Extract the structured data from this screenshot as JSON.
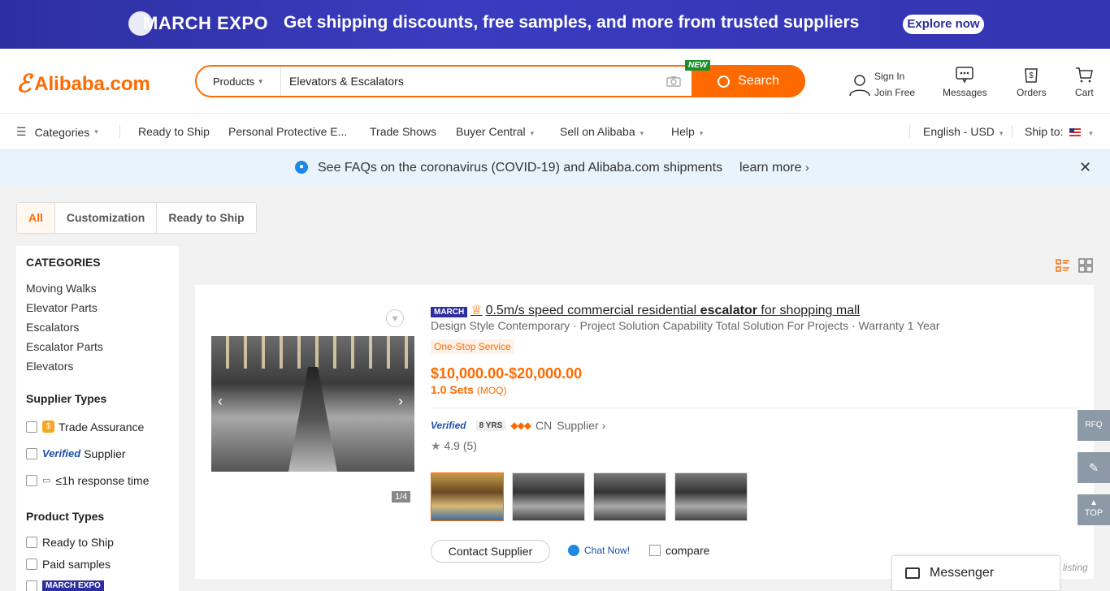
{
  "banner": {
    "logo": "MARCH EXPO",
    "tagline": "Get shipping discounts, free samples, and more from trusted suppliers",
    "cta": "Explore now"
  },
  "header": {
    "brand": "Alibaba.com",
    "search": {
      "category": "Products",
      "query": "Elevators & Escalators",
      "new_tag": "NEW",
      "button": "Search"
    },
    "account": {
      "sign_in": "Sign In",
      "join": "Join Free"
    },
    "messages": "Messages",
    "orders": "Orders",
    "cart": "Cart"
  },
  "nav": {
    "categories": "Categories",
    "items": [
      "Ready to Ship",
      "Personal Protective E...",
      "Trade Shows",
      "Buyer Central",
      "Sell on Alibaba",
      "Help"
    ],
    "language": "English - USD",
    "ship_to": "Ship to:"
  },
  "notice": {
    "message": "See FAQs on the coronavirus (COVID-19) and Alibaba.com shipments",
    "link": "learn more"
  },
  "tabs": [
    "All",
    "Customization",
    "Ready to Ship"
  ],
  "sidebar": {
    "categories_title": "CATEGORIES",
    "categories": [
      "Moving Walks",
      "Elevator Parts",
      "Escalators",
      "Escalator Parts",
      "Elevators"
    ],
    "supplier_types_title": "Supplier Types",
    "supplier_types": [
      "Trade Assurance",
      "Supplier",
      "≤1h response time"
    ],
    "verified_label": "Verified",
    "product_types_title": "Product Types",
    "product_types": [
      "Ready to Ship",
      "Paid samples"
    ],
    "march_badge": "MARCH EXPO"
  },
  "product": {
    "badge": "MARCH",
    "title_pre": "0.5m/s speed commercial residential ",
    "title_bold": "escalator",
    "title_post": " for shopping mall",
    "attributes": "Design Style Contemporary · Project Solution Capability Total Solution For Projects · Warranty 1 Year",
    "service": "One-Stop Service",
    "price": "$10,000.00-$20,000.00",
    "moq": "1.0 Sets",
    "moq_label": "(MOQ)",
    "verified": "Verified",
    "years": "8 YRS",
    "country": "CN",
    "supplier_label": "Supplier",
    "rating": "4.9",
    "reviews": "(5)",
    "image_pager": "1/4",
    "contact": "Contact Supplier",
    "chat": "Chat Now!",
    "compare": "compare"
  },
  "side_tools": [
    "RFQ",
    "",
    "TOP"
  ],
  "messenger": "Messenger",
  "listing_text": "listing"
}
